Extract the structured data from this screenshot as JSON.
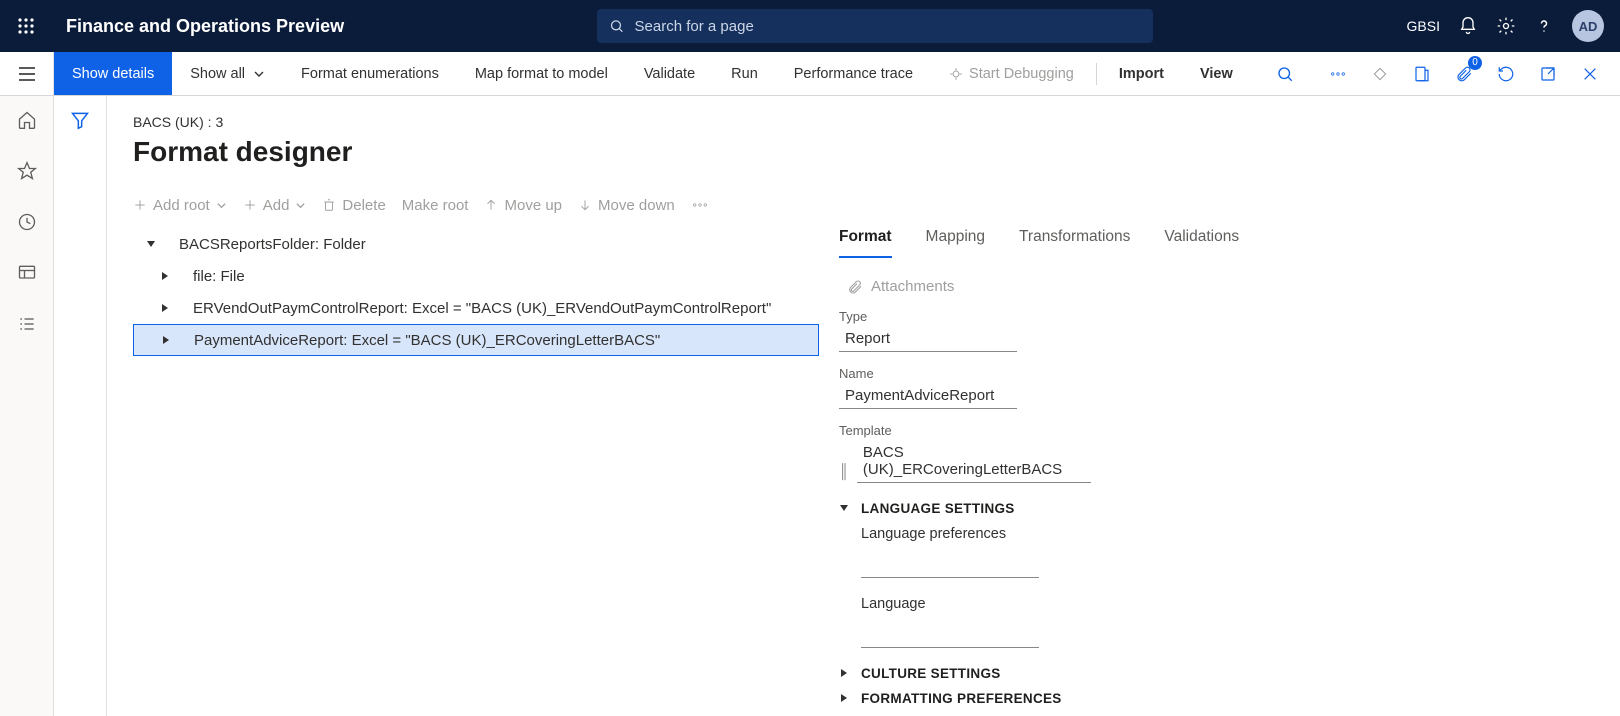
{
  "header": {
    "app_title": "Finance and Operations Preview",
    "search_placeholder": "Search for a page",
    "company": "GBSI",
    "avatar_initials": "AD"
  },
  "action_bar": {
    "show_details": "Show details",
    "show_all": "Show all",
    "format_enum": "Format enumerations",
    "map_format": "Map format to model",
    "validate": "Validate",
    "run": "Run",
    "perf_trace": "Performance trace",
    "start_debug": "Start Debugging",
    "import_": "Import",
    "view": "View",
    "attach_badge": "0"
  },
  "page": {
    "breadcrumb": "BACS (UK) : 3",
    "title": "Format designer"
  },
  "tree_toolbar": {
    "add_root": "Add root",
    "add": "Add",
    "delete": "Delete",
    "make_root": "Make root",
    "move_up": "Move up",
    "move_down": "Move down"
  },
  "tree": {
    "root": "BACSReportsFolder: Folder",
    "n1": "file: File",
    "n2": "ERVendOutPaymControlReport: Excel = \"BACS (UK)_ERVendOutPaymControlReport\"",
    "n3": "PaymentAdviceReport: Excel = \"BACS (UK)_ERCoveringLetterBACS\""
  },
  "tabs": {
    "format": "Format",
    "mapping": "Mapping",
    "transformations": "Transformations",
    "validations": "Validations"
  },
  "attachments_label": "Attachments",
  "fields": {
    "type_label": "Type",
    "type_value": "Report",
    "name_label": "Name",
    "name_value": "PaymentAdviceReport",
    "template_label": "Template",
    "template_value": "BACS (UK)_ERCoveringLetterBACS"
  },
  "sections": {
    "language_settings": "LANGUAGE SETTINGS",
    "language_preferences": "Language preferences",
    "language": "Language",
    "culture_settings": "CULTURE SETTINGS",
    "formatting_preferences": "FORMATTING PREFERENCES"
  }
}
